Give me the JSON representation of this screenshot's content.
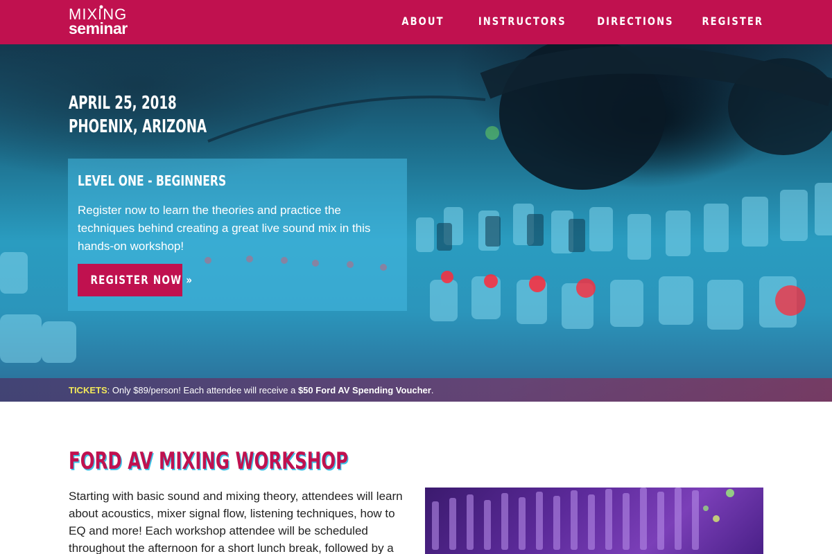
{
  "header": {
    "logo_top": "MIXING",
    "logo_bottom": "seminar",
    "nav": [
      "ABOUT",
      "INSTRUCTORS",
      "DIRECTIONS",
      "REGISTER"
    ]
  },
  "hero": {
    "date": "APRIL 25, 2018",
    "location": "PHOENIX, ARIZONA",
    "card": {
      "title": "LEVEL ONE - BEGINNERS",
      "text": "Register now to learn the theories and practice the techniques behind creating a great live sound mix in this hands-on workshop!",
      "button": "REGISTER NOW »"
    },
    "tickets": {
      "label": "TICKETS",
      "text": ": Only $89/person! Each attendee will receive a ",
      "bold": "$50 Ford AV Spending Voucher",
      "end": "."
    }
  },
  "workshop": {
    "title": "FORD AV MIXING WORKSHOP",
    "text": "Starting with basic sound and mixing theory, attendees will learn about acoustics, mixer signal flow, listening techniques, how to EQ and more! Each workshop attendee will be scheduled throughout the afternoon for a short lunch break, followed by a"
  },
  "colors": {
    "brand": "#c0114f",
    "accent": "#3cc1e6",
    "ticket_label": "#f2e85a"
  }
}
